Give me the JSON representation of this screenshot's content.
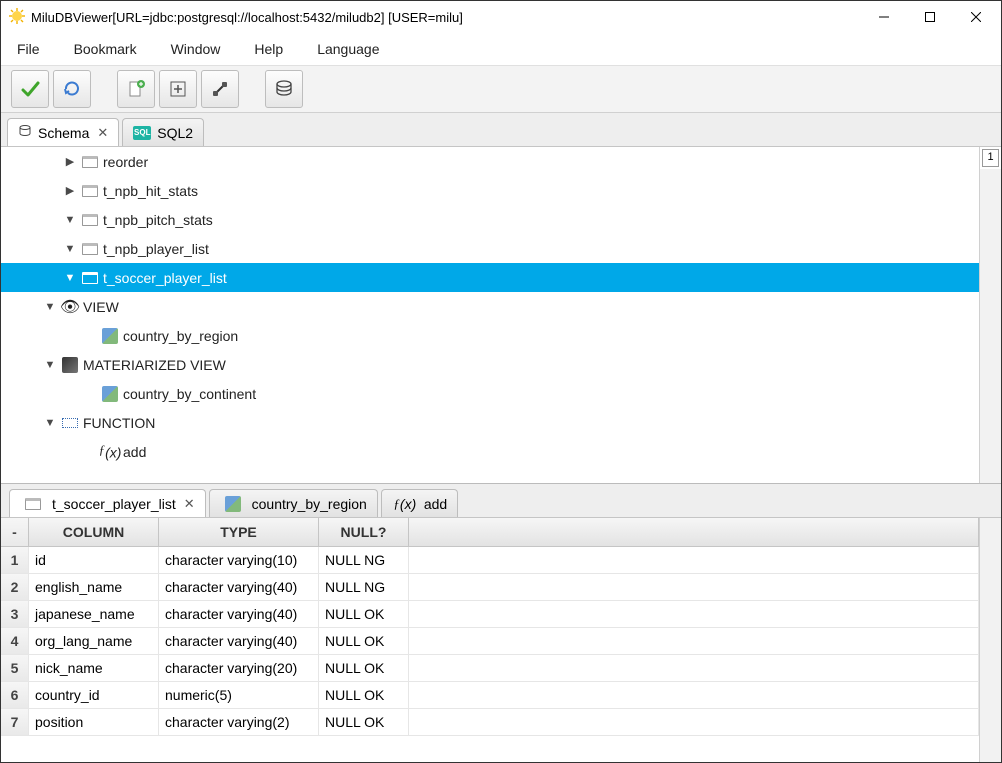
{
  "window": {
    "title": "MiluDBViewer[URL=jdbc:postgresql://localhost:5432/miludb2] [USER=milu]"
  },
  "menu": {
    "items": [
      "File",
      "Bookmark",
      "Window",
      "Help",
      "Language"
    ]
  },
  "tabs_top": [
    {
      "label": "Schema",
      "active": true,
      "closable": true,
      "icon": "db"
    },
    {
      "label": "SQL2",
      "active": false,
      "closable": false,
      "icon": "sql"
    }
  ],
  "tree": [
    {
      "indent": 62,
      "arrow": "▶",
      "icon": "table",
      "label": "reorder",
      "sel": false
    },
    {
      "indent": 62,
      "arrow": "▶",
      "icon": "table",
      "label": "t_npb_hit_stats",
      "sel": false
    },
    {
      "indent": 62,
      "arrow": "▼",
      "icon": "table",
      "label": "t_npb_pitch_stats",
      "sel": false
    },
    {
      "indent": 62,
      "arrow": "▼",
      "icon": "table",
      "label": "t_npb_player_list",
      "sel": false
    },
    {
      "indent": 62,
      "arrow": "▼",
      "icon": "table",
      "label": "t_soccer_player_list",
      "sel": true
    },
    {
      "indent": 42,
      "arrow": "▼",
      "icon": "eye",
      "label": "VIEW",
      "sel": false
    },
    {
      "indent": 82,
      "arrow": "",
      "icon": "img",
      "label": "country_by_region",
      "sel": false
    },
    {
      "indent": 42,
      "arrow": "▼",
      "icon": "mat",
      "label": "MATERIARIZED VIEW",
      "sel": false
    },
    {
      "indent": 82,
      "arrow": "",
      "icon": "img",
      "label": "country_by_continent",
      "sel": false
    },
    {
      "indent": 42,
      "arrow": "▼",
      "icon": "func",
      "label": "FUNCTION",
      "sel": false
    },
    {
      "indent": 82,
      "arrow": "",
      "icon": "fx",
      "label": "add",
      "sel": false
    }
  ],
  "right_indicator": "1",
  "tabs_bottom": [
    {
      "label": "t_soccer_player_list",
      "icon": "table",
      "closable": true,
      "active": true
    },
    {
      "label": "country_by_region",
      "icon": "img",
      "closable": false,
      "active": false
    },
    {
      "label": "add",
      "icon": "fx",
      "closable": false,
      "active": false
    }
  ],
  "grid": {
    "headers": {
      "num": "-",
      "column": "COLUMN",
      "type": "TYPE",
      "null": "NULL?"
    },
    "rows": [
      {
        "n": "1",
        "column": "id",
        "type": "character varying(10)",
        "null": "NULL NG"
      },
      {
        "n": "2",
        "column": "english_name",
        "type": "character varying(40)",
        "null": "NULL NG"
      },
      {
        "n": "3",
        "column": "japanese_name",
        "type": "character varying(40)",
        "null": "NULL OK"
      },
      {
        "n": "4",
        "column": "org_lang_name",
        "type": "character varying(40)",
        "null": "NULL OK"
      },
      {
        "n": "5",
        "column": "nick_name",
        "type": "character varying(20)",
        "null": "NULL OK"
      },
      {
        "n": "6",
        "column": "country_id",
        "type": "numeric(5)",
        "null": "NULL OK"
      },
      {
        "n": "7",
        "column": "position",
        "type": "character varying(2)",
        "null": "NULL OK"
      }
    ]
  }
}
